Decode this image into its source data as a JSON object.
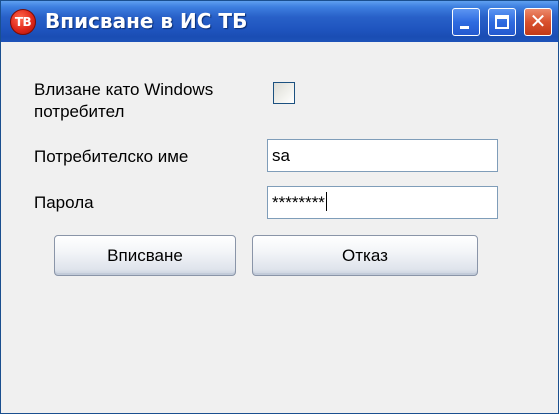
{
  "window": {
    "title": "Вписване в ИС ТБ",
    "app_icon_text": "TB",
    "close_glyph": "✕"
  },
  "form": {
    "windows_login_label_line1": "Влизане като Windows",
    "windows_login_label_line2": "потребител",
    "windows_login_checked": false,
    "username_label": "Потребителско име",
    "username_value": "sa",
    "password_label": "Парола",
    "password_value": "********"
  },
  "buttons": {
    "login_label": "Вписване",
    "cancel_label": "Отказ"
  },
  "colors": {
    "titlebar": "#2860c8",
    "close_button": "#d9512e",
    "window_background": "#f0f0f0"
  }
}
